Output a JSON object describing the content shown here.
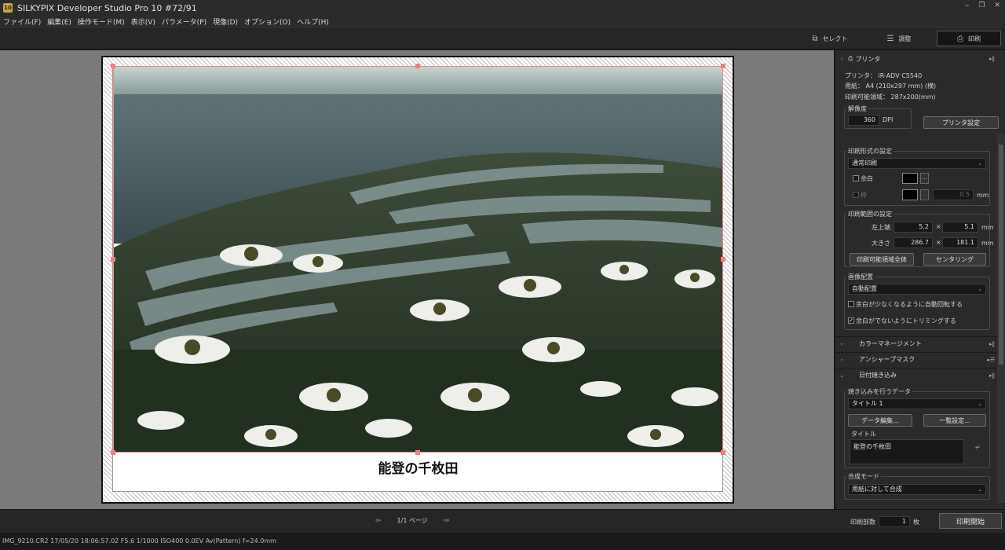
{
  "window": {
    "title": "SILKYPIX Developer Studio Pro 10   #72/91",
    "icon_text": "10",
    "controls": [
      "minimize-icon",
      "restore-icon",
      "close-icon"
    ]
  },
  "menu": [
    "ファイル(F)",
    "編集(E)",
    "操作モード(M)",
    "表示(V)",
    "パラメータ(P)",
    "現像(D)",
    "オプション(O)",
    "ヘルプ(H)"
  ],
  "modes": {
    "select": "セレクト",
    "adjust": "調整",
    "print": "印刷"
  },
  "canvas": {
    "caption": "能登の千枚田"
  },
  "bottom": {
    "page_label": "1/1 ページ",
    "copies_label": "印刷部数",
    "copies_value": "1",
    "copies_unit": "枚",
    "print_button": "印刷開始"
  },
  "status": {
    "text": "IMG_9210.CR2 17/05/20 18:06:57.02 F5.6 1/1000 ISO400  0.0EV Av(Pattern) f=24.0mm"
  },
  "panel": {
    "printer_section": "プリンタ",
    "printer_line": "プリンタ： iR-ADV C5540",
    "paper_line": "用紙： A4 (210x297 mm) (横)",
    "area_line": "印刷可能領域： 287x200(mm)",
    "resolution": {
      "title": "解像度",
      "value": "360",
      "unit": "DPI"
    },
    "printer_settings_button": "プリンタ設定",
    "format": {
      "title": "印刷形式の設定",
      "mode": "通常印刷",
      "margin_label": "余白",
      "frame_label": "枠",
      "frame_value": "0.5",
      "frame_unit": "mm",
      "dots": "..."
    },
    "range": {
      "title": "印刷範囲の設定",
      "topleft_label": "左上端",
      "topleft_x": "5.2",
      "topleft_y": "5.1",
      "size_label": "大きさ",
      "size_w": "286.7",
      "size_h": "181.1",
      "times": "×",
      "unit": "mm",
      "whole_button": "印刷可能領域全体",
      "center_button": "センタリング"
    },
    "placement": {
      "title": "画像配置",
      "mode": "自動配置",
      "auto_rotate": "余白が少なくなるように自動回転する",
      "auto_rotate_checked": false,
      "trim": "余白がでないようにトリミングする",
      "trim_checked": true
    },
    "color_mgmt": "カラーマネージメント",
    "unsharp": "アンシャープマスク",
    "date_imprint": "日付焼き込み",
    "imprint": {
      "title": "焼き込みを行うデータ",
      "data": "タイトル 1",
      "edit_button": "データ編集...",
      "list_button": "一覧設定...",
      "text_label": "タイトル",
      "text_value": "能登の千枚田"
    },
    "composite": {
      "title": "合成モード",
      "mode": "用紙に対して合成"
    }
  }
}
